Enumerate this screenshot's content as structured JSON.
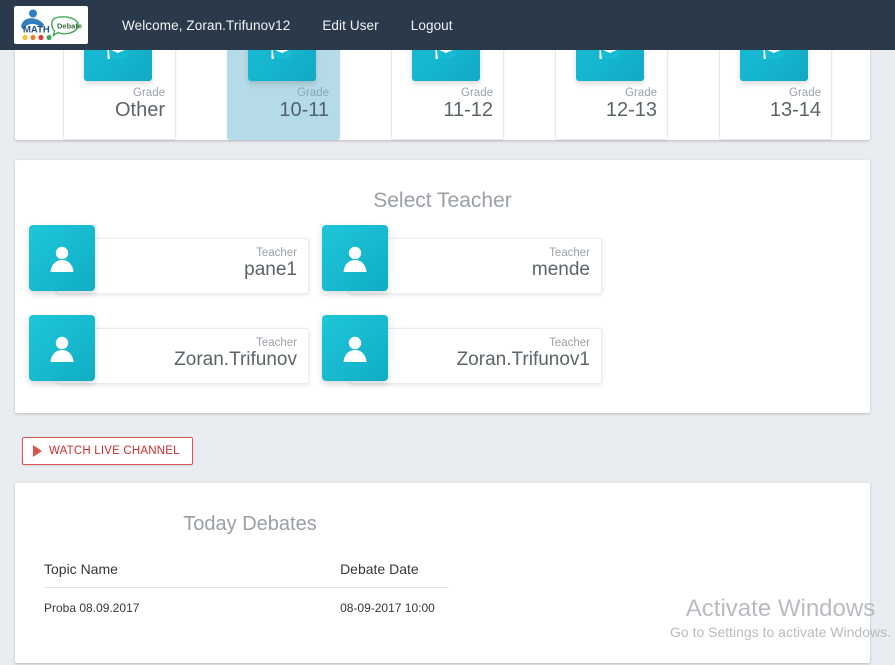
{
  "header": {
    "logo": {
      "name": "math-debate-logo",
      "text_math": "MATH",
      "text_debate": "Debate"
    },
    "nav": [
      {
        "label": "Welcome, Zoran.Trifunov12",
        "name": "nav-welcome"
      },
      {
        "label": "Edit User",
        "name": "nav-edit-user"
      },
      {
        "label": "Logout",
        "name": "nav-logout"
      }
    ]
  },
  "grades": {
    "sub_label": "Grade",
    "cards": [
      {
        "title": "Other",
        "selected": false
      },
      {
        "title": "10-11",
        "selected": true
      },
      {
        "title": "11-12",
        "selected": false
      },
      {
        "title": "12-13",
        "selected": false
      },
      {
        "title": "13-14",
        "selected": false
      }
    ]
  },
  "teachers": {
    "heading": "Select Teacher",
    "sub_label": "Teacher",
    "cards": [
      {
        "name": "pane1"
      },
      {
        "name": "mende"
      },
      {
        "name": "Zoran.Trifunov"
      },
      {
        "name": "Zoran.Trifunov1"
      }
    ]
  },
  "watch_live": {
    "label": "WATCH LIVE CHANNEL"
  },
  "debates": {
    "heading": "Today Debates",
    "columns": [
      "Topic Name",
      "Debate Date"
    ],
    "rows": [
      {
        "topic": "Proba 08.09.2017",
        "date": "08-09-2017 10:00"
      }
    ]
  },
  "watermark": {
    "line1": "Activate Windows",
    "line2": "Go to Settings to activate Windows."
  },
  "colors": {
    "navbar": "#2b3a4a",
    "page_bg": "#e9ecf0",
    "accent_teal": "#16b9ce",
    "selected_card": "#b6dbe8",
    "danger_red": "#d9534f"
  }
}
